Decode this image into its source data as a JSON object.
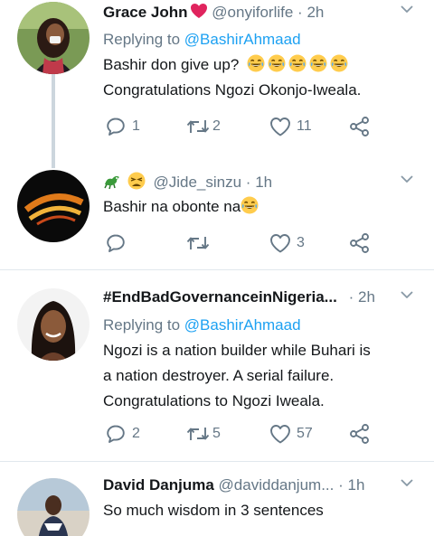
{
  "tweets": [
    {
      "name": "Grace John",
      "name_emoji": "heart-emoji",
      "handle": "@onyiforlife",
      "dot": "·",
      "time": "2h",
      "replying_prefix": "Replying to ",
      "replying_to": "@BashirAhmaad",
      "lines": [
        "Bashir don give up?",
        "Congratulations Ngozi Okonjo-Iweala."
      ],
      "reply_count": "1",
      "retweet_count": "2",
      "like_count": "11"
    },
    {
      "name_emojis": [
        "dragon-emoji",
        "tired-face-emoji"
      ],
      "handle": "@Jide_sinzu",
      "dot": "·",
      "time": "1h",
      "lines": [
        "Bashir na obonte na"
      ],
      "reply_count": "",
      "retweet_count": "",
      "like_count": "3"
    },
    {
      "name": "#EndBadGovernanceinNigeria...",
      "dot": "·",
      "time": "2h",
      "replying_prefix": "Replying to ",
      "replying_to": "@BashirAhmaad",
      "lines": [
        "Ngozi is a nation builder while Buhari is",
        "a nation destroyer. A serial failure.",
        "Congratulations to Ngozi Iweala."
      ],
      "reply_count": "2",
      "retweet_count": "5",
      "like_count": "57"
    },
    {
      "name": "David Danjuma",
      "handle": "@daviddanjum...",
      "dot": "·",
      "time": "1h",
      "lines": [
        "So much wisdom in 3 sentences"
      ]
    }
  ],
  "icons": {
    "reply": "reply-icon",
    "retweet": "retweet-icon",
    "like": "heart-icon",
    "share": "share-icon",
    "caret": "chevron-down-icon",
    "laugh": "laughing-face-emoji"
  },
  "colors": {
    "text": "#14171a",
    "secondary": "#657786",
    "link": "#1da1f2",
    "divider": "#e1e8ed",
    "thread_line": "#ccd6dd"
  }
}
